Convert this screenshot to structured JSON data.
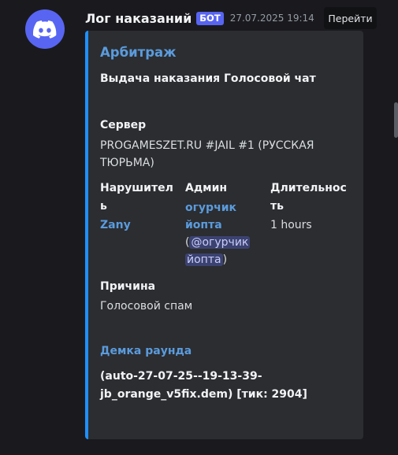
{
  "message": {
    "username": "Лог наказаний",
    "badge": "БОТ",
    "timestamp": "27.07.2025 19:14",
    "jump_label": "Перейти"
  },
  "embed": {
    "accent_color": "#1e90ff",
    "title": "Арбитраж",
    "description": "Выдача наказания Голосовой чат",
    "fields": {
      "server": {
        "name": "Сервер",
        "value_line1": "PROGAMESZET.RU #JAIL #1 (РУССКАЯ",
        "value_line2": "ТЮРЬМА)"
      },
      "violator": {
        "name_line1": "Нарушител",
        "name_line2": "ь",
        "value": "Zany"
      },
      "admin": {
        "name": "Админ",
        "link_line1": "огурчик",
        "link_line2": "йопта",
        "mention_open": "(",
        "mention_line1": "@огурчик",
        "mention_line2": "йопта",
        "mention_close": ")"
      },
      "duration": {
        "name_line1": "Длительнос",
        "name_line2": "ть",
        "value": "1 hours"
      },
      "reason": {
        "name": "Причина",
        "value": "Голосовой спам"
      },
      "demo": {
        "name": "Демка раунда",
        "value_line1": "(auto-27-07-25--19-13-39-",
        "value_line2": "jb_orange_v5fix.dem) [тик: 2904]"
      }
    }
  },
  "icons": {
    "avatar": "discord-logo-icon"
  }
}
